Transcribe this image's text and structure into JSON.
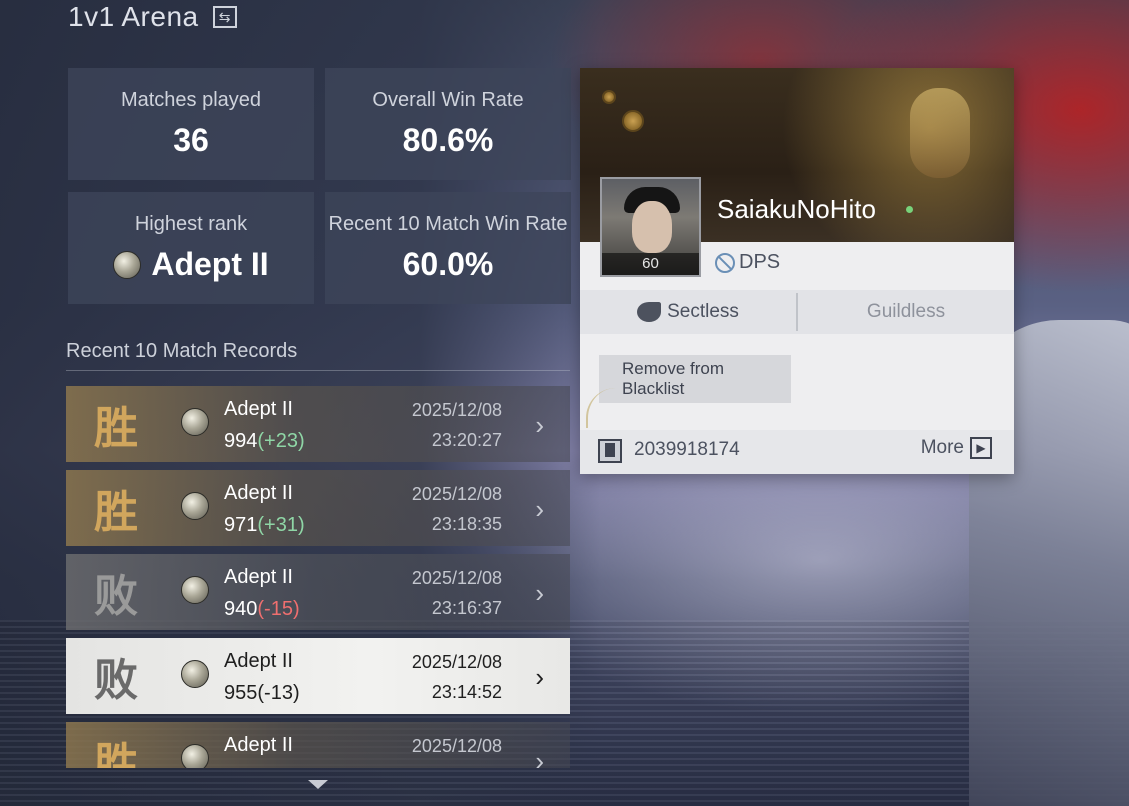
{
  "header": {
    "title": "1v1 Arena",
    "swap_icon": "swap-icon"
  },
  "stats": {
    "matches_played": {
      "label": "Matches played",
      "value": "36"
    },
    "overall_win_rate": {
      "label": "Overall Win Rate",
      "value": "80.6%"
    },
    "highest_rank": {
      "label": "Highest rank",
      "value": "Adept II",
      "icon": "rank-coin-icon"
    },
    "recent_win_rate": {
      "label": "Recent 10 Match Win Rate",
      "value": "60.0%"
    }
  },
  "records": {
    "title": "Recent 10 Match Records",
    "rows": [
      {
        "result": "win",
        "glyph": "胜",
        "rank": "Adept II",
        "score": "994",
        "delta": "(+23)",
        "date": "2025/12/08",
        "time": "23:20:27"
      },
      {
        "result": "win",
        "glyph": "胜",
        "rank": "Adept II",
        "score": "971",
        "delta": "(+31)",
        "date": "2025/12/08",
        "time": "23:18:35"
      },
      {
        "result": "loss",
        "glyph": "败",
        "rank": "Adept II",
        "score": "940",
        "delta": "(-15)",
        "date": "2025/12/08",
        "time": "23:16:37"
      },
      {
        "result": "loss",
        "glyph": "败",
        "rank": "Adept II",
        "score": "955",
        "delta": "(-13)",
        "date": "2025/12/08",
        "time": "23:14:52",
        "selected": true
      },
      {
        "result": "win",
        "glyph": "胜",
        "rank": "Adept II",
        "score": "",
        "delta": "",
        "date": "2025/12/08",
        "time": ""
      }
    ]
  },
  "profile": {
    "name": "SaiakuNoHito",
    "online": true,
    "level": "60",
    "role": "DPS",
    "sect": "Sectless",
    "guild": "Guildless",
    "blacklist_button": "Remove from Blacklist",
    "uid": "2039918174",
    "more": "More"
  },
  "colors": {
    "win_glyph": "#d1a65d",
    "loss_glyph": "#9a9a9a",
    "delta_positive": "#8fd6a6",
    "delta_negative": "#ef6f6f",
    "online_dot": "#78d27a"
  }
}
